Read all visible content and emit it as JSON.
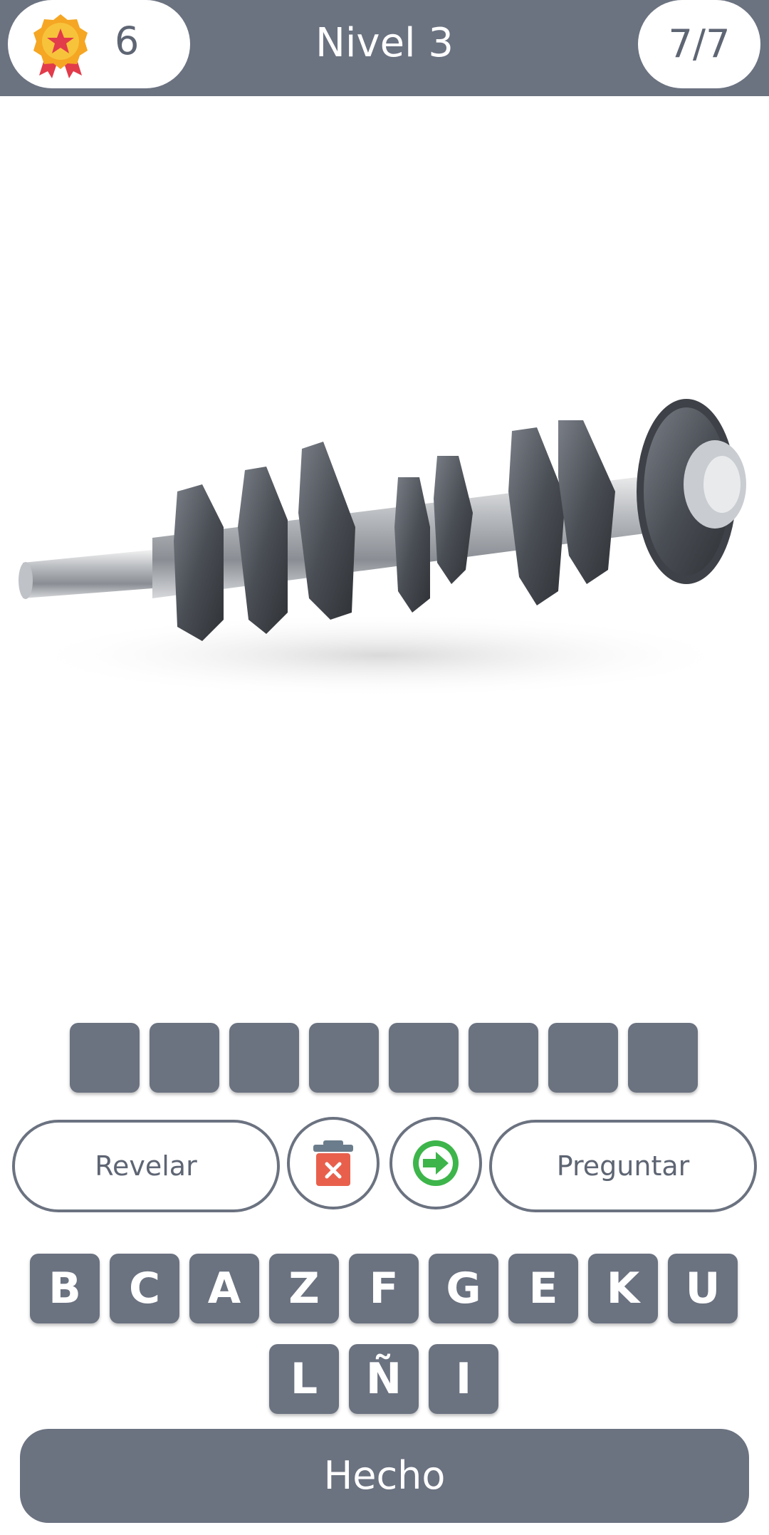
{
  "header": {
    "score": "6",
    "level_title": "Nivel 3",
    "progress": "7/7",
    "medal_icon": "medal-star-icon"
  },
  "image": {
    "subject_icon": "crankshaft-photo"
  },
  "answer": {
    "slot_count": 8,
    "slots": [
      "",
      "",
      "",
      "",
      "",
      "",
      "",
      ""
    ]
  },
  "actions": {
    "reveal_label": "Revelar",
    "ask_label": "Preguntar",
    "delete_icon": "trash-icon",
    "skip_icon": "arrow-right-icon"
  },
  "keyboard": {
    "row1": [
      "B",
      "C",
      "A",
      "Z",
      "F",
      "G",
      "E",
      "K",
      "U"
    ],
    "row2": [
      "L",
      "Ñ",
      "I"
    ]
  },
  "done_label": "Hecho",
  "colors": {
    "header_bg": "#6b7280",
    "tile_bg": "#6b7280",
    "delete_red": "#e8604c",
    "skip_green": "#3db54a"
  }
}
